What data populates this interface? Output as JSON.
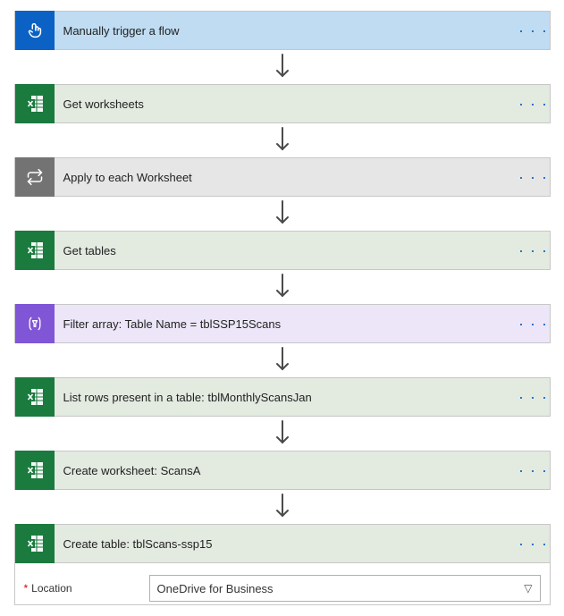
{
  "steps": [
    {
      "title": "Manually trigger a flow",
      "theme": "trigger",
      "icon": "touch"
    },
    {
      "title": "Get worksheets",
      "theme": "excel",
      "icon": "excel"
    },
    {
      "title": "Apply to each Worksheet",
      "theme": "loop",
      "icon": "loop"
    },
    {
      "title": "Get tables",
      "theme": "excel",
      "icon": "excel"
    },
    {
      "title": "Filter array: Table Name = tblSSP15Scans",
      "theme": "filter",
      "icon": "filter"
    },
    {
      "title": "List rows present in a table: tblMonthlyScansJan",
      "theme": "excel",
      "icon": "excel"
    },
    {
      "title": "Create worksheet: ScansA",
      "theme": "excel",
      "icon": "excel"
    },
    {
      "title": "Create table: tblScans-ssp15",
      "theme": "excel",
      "icon": "excel"
    }
  ],
  "expanded": {
    "step_index": 7,
    "params": [
      {
        "label": "Location",
        "required": true,
        "value": "OneDrive for Business"
      }
    ]
  },
  "menu_glyph": "· · ·"
}
